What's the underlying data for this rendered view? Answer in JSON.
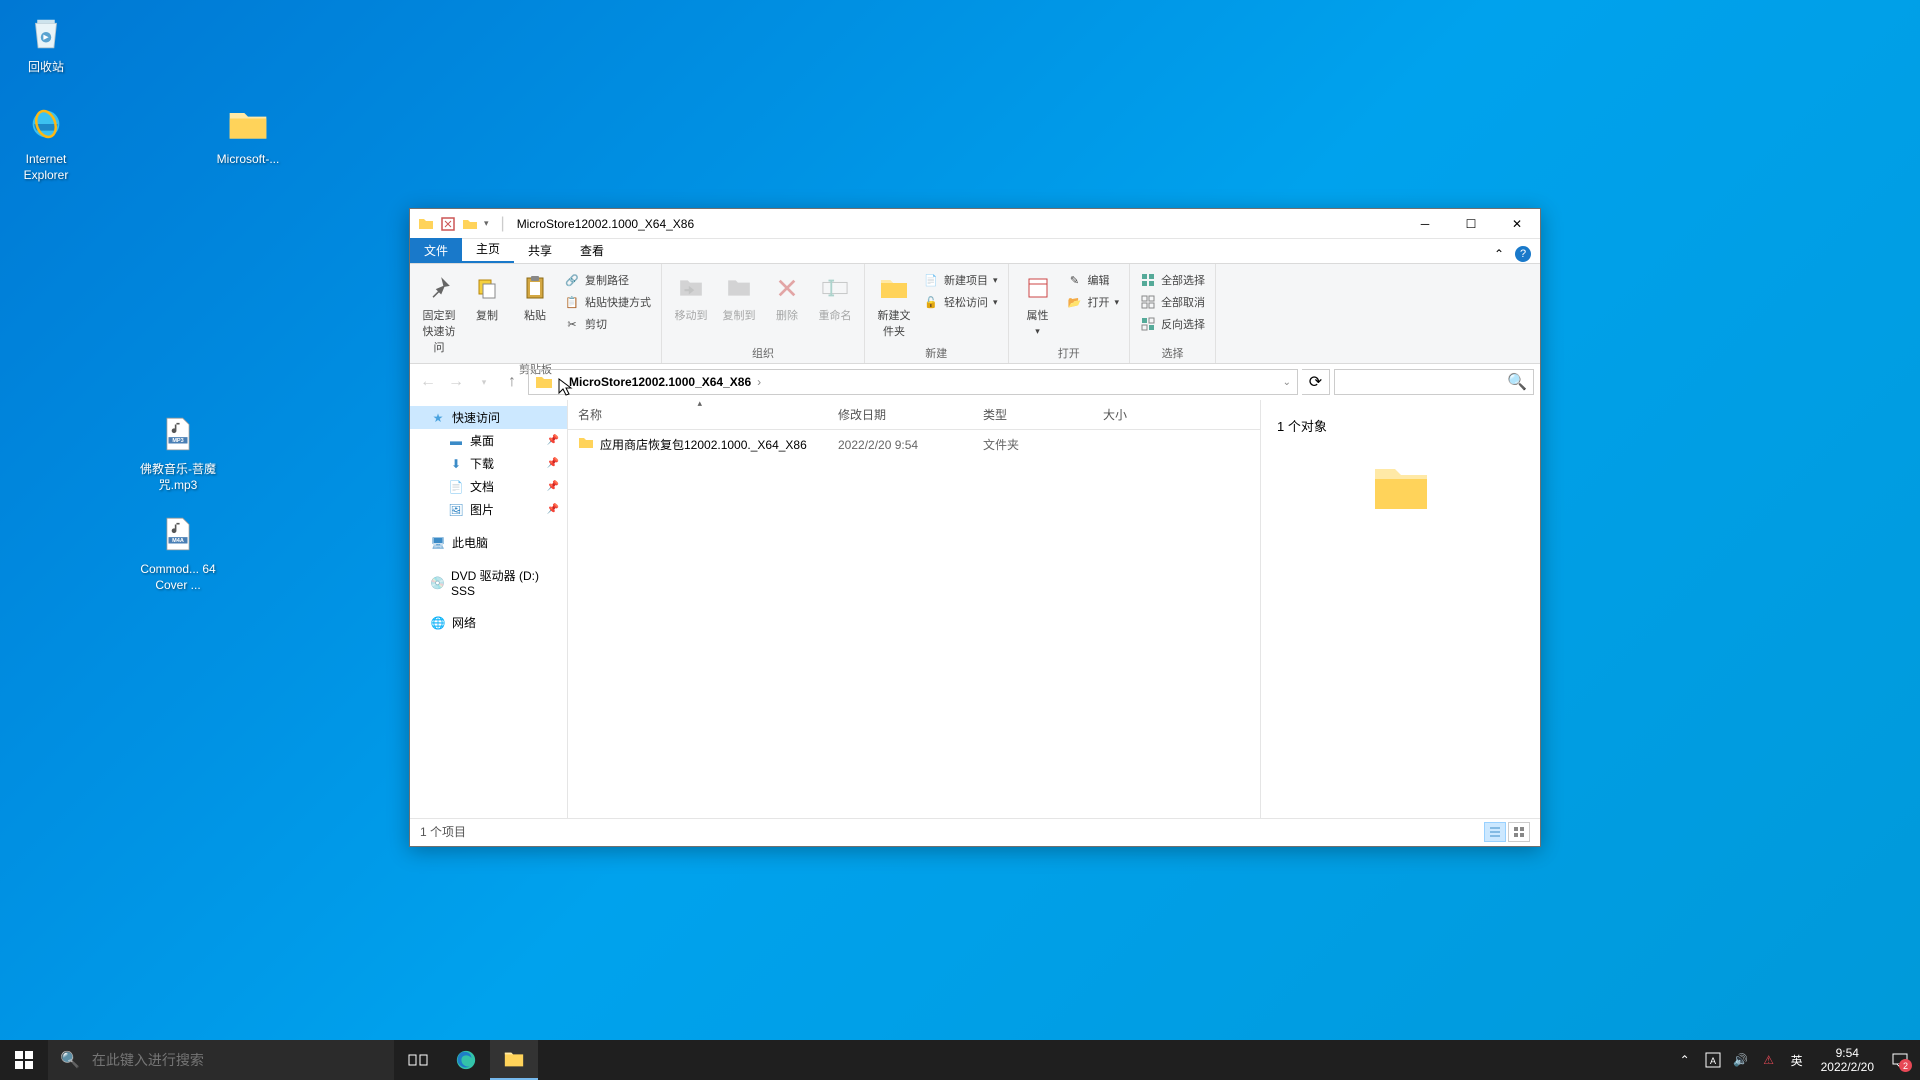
{
  "desktop": {
    "recycle": "回收站",
    "ie": "Internet Explorer",
    "msfolder": "Microsoft-...",
    "mp3": "佛教音乐-菩魔咒.mp3",
    "m4a": "Commod... 64 Cover ..."
  },
  "window": {
    "title": "MicroStore12002.1000_X64_X86",
    "tabs": {
      "file": "文件",
      "home": "主页",
      "share": "共享",
      "view": "查看"
    },
    "ribbon": {
      "clipboard": {
        "pin": "固定到快速访问",
        "copy": "复制",
        "paste": "粘贴",
        "cut": "剪切",
        "copypath": "复制路径",
        "pasteshortcut": "粘贴快捷方式",
        "label": "剪贴板"
      },
      "organize": {
        "moveto": "移动到",
        "copyto": "复制到",
        "delete": "删除",
        "rename": "重命名",
        "label": "组织"
      },
      "new": {
        "newfolder": "新建文件夹",
        "newitem": "新建项目",
        "easyaccess": "轻松访问",
        "label": "新建"
      },
      "open": {
        "properties": "属性",
        "open": "打开",
        "edit": "编辑",
        "label": "打开"
      },
      "select": {
        "selectall": "全部选择",
        "selectnone": "全部取消",
        "invert": "反向选择",
        "label": "选择"
      }
    },
    "breadcrumb": "MicroStore12002.1000_X64_X86",
    "nav": {
      "quick": "快速访问",
      "desktop": "桌面",
      "downloads": "下载",
      "documents": "文档",
      "pictures": "图片",
      "thispc": "此电脑",
      "dvd": "DVD 驱动器 (D:) SSS",
      "network": "网络"
    },
    "columns": {
      "name": "名称",
      "date": "修改日期",
      "type": "类型",
      "size": "大小"
    },
    "files": [
      {
        "name": "应用商店恢复包12002.1000._X64_X86",
        "date": "2022/2/20 9:54",
        "type": "文件夹",
        "size": ""
      }
    ],
    "preview": "1 个对象",
    "status": "1 个项目"
  },
  "taskbar": {
    "search_placeholder": "在此键入进行搜索",
    "ime": "英",
    "time": "9:54",
    "date": "2022/2/20",
    "notif_count": "2"
  }
}
